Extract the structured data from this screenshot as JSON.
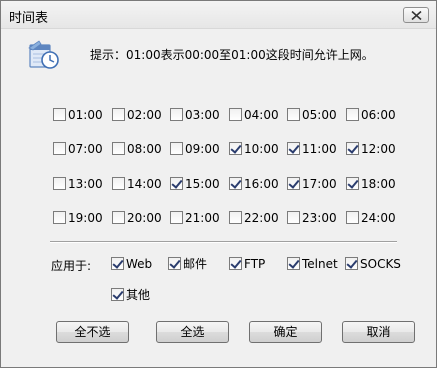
{
  "window": {
    "title": "时间表"
  },
  "hint": {
    "text": "提示：01:00表示00:00至01:00这段时间允许上网。"
  },
  "hours": [
    {
      "label": "01:00",
      "checked": false
    },
    {
      "label": "02:00",
      "checked": false
    },
    {
      "label": "03:00",
      "checked": false
    },
    {
      "label": "04:00",
      "checked": false
    },
    {
      "label": "05:00",
      "checked": false
    },
    {
      "label": "06:00",
      "checked": false
    },
    {
      "label": "07:00",
      "checked": false
    },
    {
      "label": "08:00",
      "checked": false
    },
    {
      "label": "09:00",
      "checked": false
    },
    {
      "label": "10:00",
      "checked": true
    },
    {
      "label": "11:00",
      "checked": true
    },
    {
      "label": "12:00",
      "checked": true
    },
    {
      "label": "13:00",
      "checked": false
    },
    {
      "label": "14:00",
      "checked": false
    },
    {
      "label": "15:00",
      "checked": true
    },
    {
      "label": "16:00",
      "checked": true
    },
    {
      "label": "17:00",
      "checked": true
    },
    {
      "label": "18:00",
      "checked": true
    },
    {
      "label": "19:00",
      "checked": false
    },
    {
      "label": "20:00",
      "checked": false
    },
    {
      "label": "21:00",
      "checked": false
    },
    {
      "label": "22:00",
      "checked": false
    },
    {
      "label": "23:00",
      "checked": false
    },
    {
      "label": "24:00",
      "checked": false
    }
  ],
  "apply_to": {
    "label": "应用于:",
    "options": [
      {
        "label": "Web",
        "checked": true
      },
      {
        "label": "邮件",
        "checked": true
      },
      {
        "label": "FTP",
        "checked": true
      },
      {
        "label": "Telnet",
        "checked": true
      },
      {
        "label": "SOCKS",
        "checked": true
      },
      {
        "label": "其他",
        "checked": true
      }
    ]
  },
  "buttons": {
    "deselect_all": "全不选",
    "select_all": "全选",
    "ok": "确定",
    "cancel": "取消"
  },
  "icons": {
    "close": "close-icon",
    "hint": "calendar-clock-icon"
  }
}
